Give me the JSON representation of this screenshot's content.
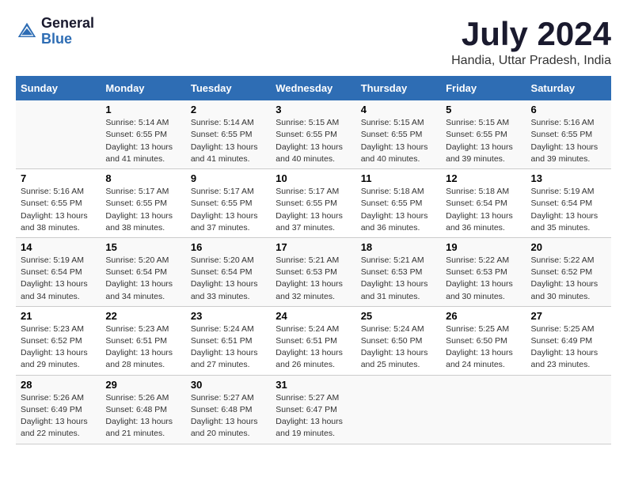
{
  "header": {
    "logo_line1": "General",
    "logo_line2": "Blue",
    "main_title": "July 2024",
    "subtitle": "Handia, Uttar Pradesh, India"
  },
  "calendar": {
    "days_of_week": [
      "Sunday",
      "Monday",
      "Tuesday",
      "Wednesday",
      "Thursday",
      "Friday",
      "Saturday"
    ],
    "weeks": [
      [
        {
          "day": "",
          "content": ""
        },
        {
          "day": "1",
          "content": "Sunrise: 5:14 AM\nSunset: 6:55 PM\nDaylight: 13 hours\nand 41 minutes."
        },
        {
          "day": "2",
          "content": "Sunrise: 5:14 AM\nSunset: 6:55 PM\nDaylight: 13 hours\nand 41 minutes."
        },
        {
          "day": "3",
          "content": "Sunrise: 5:15 AM\nSunset: 6:55 PM\nDaylight: 13 hours\nand 40 minutes."
        },
        {
          "day": "4",
          "content": "Sunrise: 5:15 AM\nSunset: 6:55 PM\nDaylight: 13 hours\nand 40 minutes."
        },
        {
          "day": "5",
          "content": "Sunrise: 5:15 AM\nSunset: 6:55 PM\nDaylight: 13 hours\nand 39 minutes."
        },
        {
          "day": "6",
          "content": "Sunrise: 5:16 AM\nSunset: 6:55 PM\nDaylight: 13 hours\nand 39 minutes."
        }
      ],
      [
        {
          "day": "7",
          "content": "Sunrise: 5:16 AM\nSunset: 6:55 PM\nDaylight: 13 hours\nand 38 minutes."
        },
        {
          "day": "8",
          "content": "Sunrise: 5:17 AM\nSunset: 6:55 PM\nDaylight: 13 hours\nand 38 minutes."
        },
        {
          "day": "9",
          "content": "Sunrise: 5:17 AM\nSunset: 6:55 PM\nDaylight: 13 hours\nand 37 minutes."
        },
        {
          "day": "10",
          "content": "Sunrise: 5:17 AM\nSunset: 6:55 PM\nDaylight: 13 hours\nand 37 minutes."
        },
        {
          "day": "11",
          "content": "Sunrise: 5:18 AM\nSunset: 6:55 PM\nDaylight: 13 hours\nand 36 minutes."
        },
        {
          "day": "12",
          "content": "Sunrise: 5:18 AM\nSunset: 6:54 PM\nDaylight: 13 hours\nand 36 minutes."
        },
        {
          "day": "13",
          "content": "Sunrise: 5:19 AM\nSunset: 6:54 PM\nDaylight: 13 hours\nand 35 minutes."
        }
      ],
      [
        {
          "day": "14",
          "content": "Sunrise: 5:19 AM\nSunset: 6:54 PM\nDaylight: 13 hours\nand 34 minutes."
        },
        {
          "day": "15",
          "content": "Sunrise: 5:20 AM\nSunset: 6:54 PM\nDaylight: 13 hours\nand 34 minutes."
        },
        {
          "day": "16",
          "content": "Sunrise: 5:20 AM\nSunset: 6:54 PM\nDaylight: 13 hours\nand 33 minutes."
        },
        {
          "day": "17",
          "content": "Sunrise: 5:21 AM\nSunset: 6:53 PM\nDaylight: 13 hours\nand 32 minutes."
        },
        {
          "day": "18",
          "content": "Sunrise: 5:21 AM\nSunset: 6:53 PM\nDaylight: 13 hours\nand 31 minutes."
        },
        {
          "day": "19",
          "content": "Sunrise: 5:22 AM\nSunset: 6:53 PM\nDaylight: 13 hours\nand 30 minutes."
        },
        {
          "day": "20",
          "content": "Sunrise: 5:22 AM\nSunset: 6:52 PM\nDaylight: 13 hours\nand 30 minutes."
        }
      ],
      [
        {
          "day": "21",
          "content": "Sunrise: 5:23 AM\nSunset: 6:52 PM\nDaylight: 13 hours\nand 29 minutes."
        },
        {
          "day": "22",
          "content": "Sunrise: 5:23 AM\nSunset: 6:51 PM\nDaylight: 13 hours\nand 28 minutes."
        },
        {
          "day": "23",
          "content": "Sunrise: 5:24 AM\nSunset: 6:51 PM\nDaylight: 13 hours\nand 27 minutes."
        },
        {
          "day": "24",
          "content": "Sunrise: 5:24 AM\nSunset: 6:51 PM\nDaylight: 13 hours\nand 26 minutes."
        },
        {
          "day": "25",
          "content": "Sunrise: 5:24 AM\nSunset: 6:50 PM\nDaylight: 13 hours\nand 25 minutes."
        },
        {
          "day": "26",
          "content": "Sunrise: 5:25 AM\nSunset: 6:50 PM\nDaylight: 13 hours\nand 24 minutes."
        },
        {
          "day": "27",
          "content": "Sunrise: 5:25 AM\nSunset: 6:49 PM\nDaylight: 13 hours\nand 23 minutes."
        }
      ],
      [
        {
          "day": "28",
          "content": "Sunrise: 5:26 AM\nSunset: 6:49 PM\nDaylight: 13 hours\nand 22 minutes."
        },
        {
          "day": "29",
          "content": "Sunrise: 5:26 AM\nSunset: 6:48 PM\nDaylight: 13 hours\nand 21 minutes."
        },
        {
          "day": "30",
          "content": "Sunrise: 5:27 AM\nSunset: 6:48 PM\nDaylight: 13 hours\nand 20 minutes."
        },
        {
          "day": "31",
          "content": "Sunrise: 5:27 AM\nSunset: 6:47 PM\nDaylight: 13 hours\nand 19 minutes."
        },
        {
          "day": "",
          "content": ""
        },
        {
          "day": "",
          "content": ""
        },
        {
          "day": "",
          "content": ""
        }
      ]
    ]
  }
}
